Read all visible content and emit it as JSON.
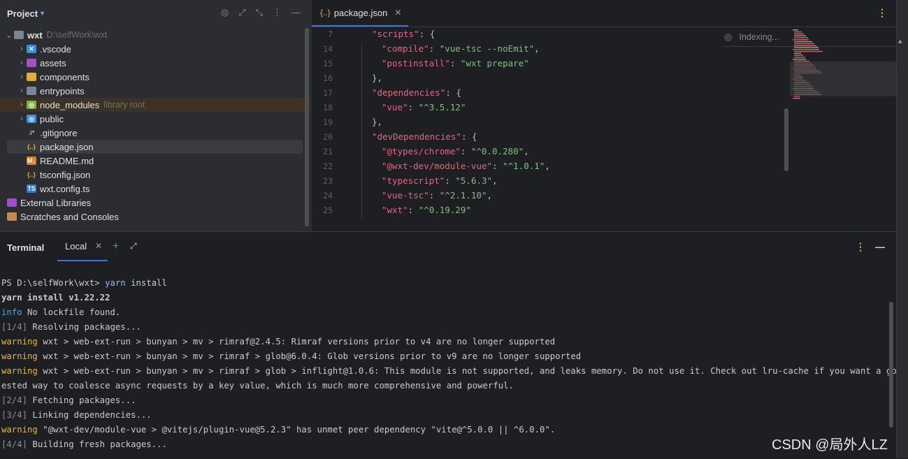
{
  "project": {
    "title": "Project",
    "tree": [
      {
        "name": "wxt",
        "hint": "D:\\selfWork\\wxt",
        "icon": "folder-icon",
        "indent": 0,
        "expanded": true
      },
      {
        "name": ".vscode",
        "icon": "vscode-folder-icon",
        "indent": 1
      },
      {
        "name": "assets",
        "icon": "assets-folder-icon",
        "indent": 1
      },
      {
        "name": "components",
        "icon": "components-folder-icon",
        "indent": 1
      },
      {
        "name": "entrypoints",
        "icon": "folder-icon",
        "indent": 1
      },
      {
        "name": "node_modules",
        "hint": "library root",
        "icon": "node-modules-folder-icon",
        "indent": 1
      },
      {
        "name": "public",
        "icon": "public-folder-icon",
        "indent": 1
      },
      {
        "name": ".gitignore",
        "icon": "gitignore-file-icon",
        "indent": 1
      },
      {
        "name": "package.json",
        "icon": "json-file-icon",
        "indent": 1
      },
      {
        "name": "README.md",
        "icon": "markdown-file-icon",
        "indent": 1
      },
      {
        "name": "tsconfig.json",
        "icon": "json-file-icon",
        "indent": 1
      },
      {
        "name": "wxt.config.ts",
        "icon": "typescript-file-icon",
        "indent": 1
      },
      {
        "name": "External Libraries",
        "icon": "library-icon",
        "indent": 0
      },
      {
        "name": "Scratches and Consoles",
        "icon": "scratches-icon",
        "indent": 0
      }
    ]
  },
  "editor": {
    "tab_label": "package.json",
    "indexing_text": "Indexing...",
    "lines": [
      {
        "num": "7",
        "text": "\"scripts\": {"
      },
      {
        "num": "14",
        "text": "\"compile\": \"vue-tsc --noEmit\","
      },
      {
        "num": "15",
        "text": "\"postinstall\": \"wxt prepare\""
      },
      {
        "num": "16",
        "text": "},"
      },
      {
        "num": "17",
        "text": "\"dependencies\": {"
      },
      {
        "num": "18",
        "text": "\"vue\": \"^3.5.12\""
      },
      {
        "num": "19",
        "text": "},"
      },
      {
        "num": "20",
        "text": "\"devDependencies\": {"
      },
      {
        "num": "21",
        "text": "\"@types/chrome\": \"^0.0.280\","
      },
      {
        "num": "22",
        "text": "\"@wxt-dev/module-vue\": \"^1.0.1\","
      },
      {
        "num": "23",
        "text": "\"typescript\": \"5.6.3\","
      },
      {
        "num": "24",
        "text": "\"vue-tsc\": \"^2.1.10\","
      },
      {
        "num": "25",
        "text": "\"wxt\": \"^0.19.29\""
      }
    ]
  },
  "terminal": {
    "title": "Terminal",
    "tab_label": "Local",
    "lines": [
      "PS D:\\selfWork\\wxt> yarn install",
      "yarn install v1.22.22",
      "info No lockfile found.",
      "[1/4] Resolving packages...",
      "warning wxt > web-ext-run > bunyan > mv > rimraf@2.4.5: Rimraf versions prior to v4 are no longer supported",
      "warning wxt > web-ext-run > bunyan > mv > rimraf > glob@6.0.4: Glob versions prior to v9 are no longer supported",
      "warning wxt > web-ext-run > bunyan > mv > rimraf > glob > inflight@1.0.6: This module is not supported, and leaks memory. Do not use it. Check out lru-cache if you want a good and t",
      "ested way to coalesce async requests by a key value, which is much more comprehensive and powerful.",
      "[2/4] Fetching packages...",
      "[3/4] Linking dependencies...",
      "warning \"@wxt-dev/module-vue > @vitejs/plugin-vue@5.2.3\" has unmet peer dependency \"vite@^5.0.0 || ^6.0.0\".",
      "[4/4] Building fresh packages..."
    ]
  },
  "watermark": "CSDN @局外人LZ",
  "colors": {
    "accent": "#3574f0",
    "warning": "#e5b93c",
    "info": "#5aa5e0"
  }
}
